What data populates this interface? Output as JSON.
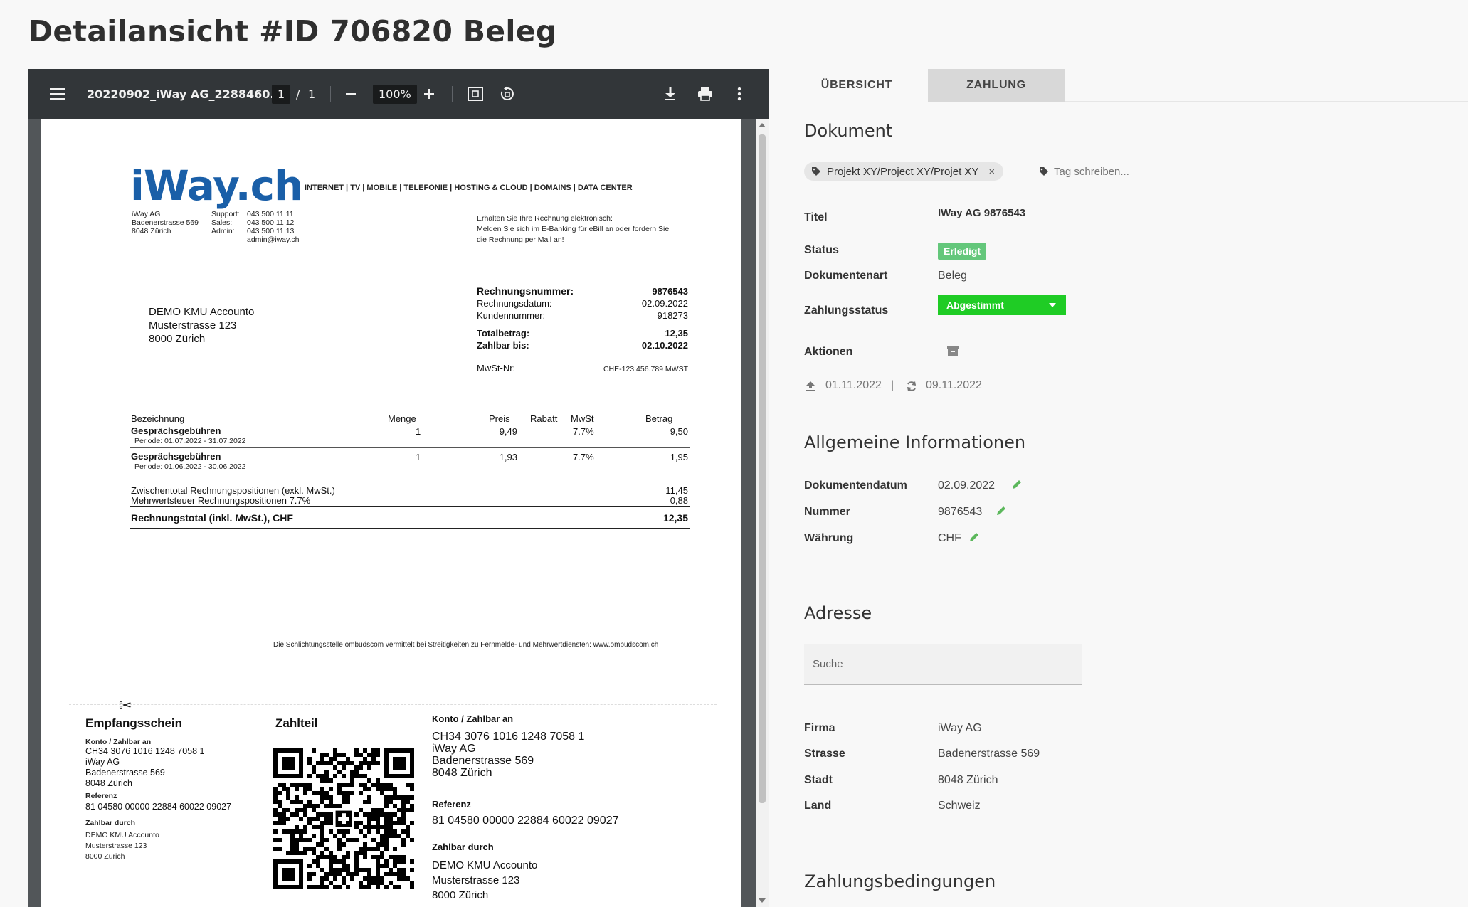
{
  "page": {
    "title": "Detailansicht #ID 706820 Beleg"
  },
  "viewer": {
    "filename": "20220902_iWay AG_2288460...",
    "page_current": "1",
    "page_separator": "/",
    "page_total": "1",
    "zoom": "100%",
    "icons": [
      "menu-icon",
      "zoom-out-icon",
      "zoom-in-icon",
      "fit-page-icon",
      "rotate-icon",
      "download-icon",
      "print-icon",
      "more-vert-icon"
    ]
  },
  "pdf": {
    "logo": "iWay.ch",
    "services": "INTERNET | TV | MOBILE | TELEFONIE | HOSTING & CLOUD | DOMAINS | DATA CENTER",
    "sender": [
      "iWay AG",
      "Badenerstrasse 569",
      "8048 Zürich"
    ],
    "contacts": [
      {
        "label": "Support:",
        "value": "043 500 11 11"
      },
      {
        "label": "Sales:",
        "value": "043 500 11 12"
      },
      {
        "label": "Admin:",
        "value": "043 500 11 13"
      }
    ],
    "email": "admin@iway.ch",
    "ebill_note": [
      "Erhalten Sie Ihre Rechnung elektronisch:",
      "Melden Sie sich im E-Banking für eBill an oder fordern Sie",
      "die Rechnung per Mail an!"
    ],
    "recipient": [
      "DEMO KMU Accounto",
      "Musterstrasse 123",
      "8000 Zürich"
    ],
    "invoice_info": {
      "number_label": "Rechnungsnummer:",
      "number": "9876543",
      "date_label": "Rechnungsdatum:",
      "date": "02.09.2022",
      "customer_label": "Kundennummer:",
      "customer": "918273",
      "total_label": "Totalbetrag:",
      "total": "12,35",
      "due_label": "Zahlbar bis:",
      "due": "02.10.2022",
      "vat_label": "MwSt-Nr:",
      "vat": "CHE-123.456.789 MWST"
    },
    "table": {
      "headers": [
        "Bezeichnung",
        "Menge",
        "Preis",
        "Rabatt",
        "MwSt",
        "Betrag"
      ],
      "rows": [
        {
          "desc": "Gesprächsgebühren",
          "period": "Periode: 01.07.2022 - 31.07.2022",
          "qty": "1",
          "price": "9,49",
          "discount": "",
          "vat": "7.7%",
          "amount": "9,50"
        },
        {
          "desc": "Gesprächsgebühren",
          "period": "Periode: 01.06.2022 - 30.06.2022",
          "qty": "1",
          "price": "1,93",
          "discount": "",
          "vat": "7.7%",
          "amount": "1,95"
        }
      ],
      "subtotal_label": "Zwischentotal Rechnungspositionen (exkl. MwSt.)",
      "subtotal": "11,45",
      "vat_line_label": "Mehrwertsteuer Rechnungspositionen 7.7%",
      "vat_line": "0,88",
      "grand_total_label": "Rechnungstotal (inkl. MwSt.), CHF",
      "grand_total": "12,35"
    },
    "ombudscom": "Die Schlichtungsstelle ombudscom vermittelt bei Streitigkeiten zu Fernmelde- und Mehrwertdiensten: www.ombudscom.ch",
    "receipt": {
      "title": "Empfangsschein",
      "account_label": "Konto / Zahlbar an",
      "account": [
        "CH34 3076 1016 1248 7058 1",
        "iWay AG",
        "Badenerstrasse 569",
        "8048 Zürich"
      ],
      "reference_label": "Referenz",
      "reference": "81 04580 00000 22884 60022 09027",
      "payer_label": "Zahlbar durch",
      "payer": [
        "DEMO KMU Accounto",
        "Musterstrasse 123",
        "8000 Zürich"
      ]
    },
    "payment_part": {
      "title": "Zahlteil",
      "account_label": "Konto / Zahlbar an",
      "account": [
        "CH34 3076 1016 1248 7058 1",
        "iWay AG",
        "Badenerstrasse 569",
        "8048 Zürich"
      ],
      "reference_label": "Referenz",
      "reference": "81 04580 00000 22884 60022 09027",
      "payer_label": "Zahlbar durch",
      "payer": [
        "DEMO KMU Accounto",
        "Musterstrasse 123",
        "8000 Zürich"
      ]
    }
  },
  "tabs": [
    {
      "label": "ÜBERSICHT",
      "active": true
    },
    {
      "label": "ZAHLUNG",
      "active": false
    }
  ],
  "document": {
    "heading": "Dokument",
    "tag": "Projekt XY/Project XY/Projet XY",
    "tag_remove": "×",
    "tag_placeholder": "Tag schreiben...",
    "fields": {
      "title_label": "Titel",
      "title": "IWay AG 9876543",
      "status_label": "Status",
      "status": "Erledigt",
      "doctype_label": "Dokumentenart",
      "doctype": "Beleg",
      "paystatus_label": "Zahlungsstatus",
      "paystatus": "Abgestimmt",
      "actions_label": "Aktionen"
    },
    "uploaded": "01.11.2022",
    "date_separator": "|",
    "synced": "09.11.2022"
  },
  "general": {
    "heading": "Allgemeine Informationen",
    "docdate_label": "Dokumentendatum",
    "docdate": "02.09.2022",
    "number_label": "Nummer",
    "number": "9876543",
    "currency_label": "Währung",
    "currency": "CHF"
  },
  "address": {
    "heading": "Adresse",
    "search_placeholder": "Suche",
    "company_label": "Firma",
    "company": "iWay AG",
    "street_label": "Strasse",
    "street": "Badenerstrasse 569",
    "city_label": "Stadt",
    "city": "8048 Zürich",
    "country_label": "Land",
    "country": "Schweiz"
  },
  "payment_terms": {
    "heading": "Zahlungsbedingungen"
  },
  "colors": {
    "status_green": "#64c77b",
    "select_green": "#1fcc25",
    "pencil_green": "#5cb85c",
    "logo_blue": "#1a5fa8",
    "toolbar": "#323639"
  }
}
